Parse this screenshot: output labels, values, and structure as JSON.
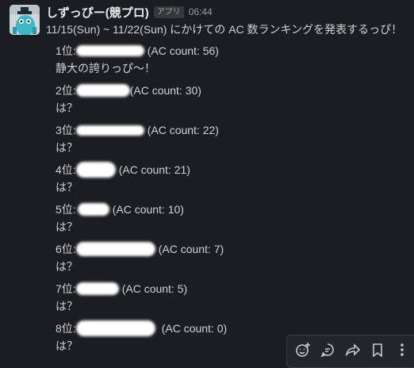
{
  "message": {
    "author": "しずっぴー(競プロ)",
    "badge": "アプリ",
    "time": "06:44",
    "intro": "11/15(Sun) ~ 11/22(Sun) にかけての AC 数ランキングを発表するっぴ！"
  },
  "ranks": [
    {
      "place": "1位:",
      "count": "(AC count: 56)",
      "comment": "静大の誇りっぴ〜！"
    },
    {
      "place": "2位:",
      "count": "(AC count: 30)",
      "comment": "は？"
    },
    {
      "place": "3位:",
      "count": "(AC count: 22)",
      "comment": "は？"
    },
    {
      "place": "4位:",
      "count": "(AC count: 21)",
      "comment": "は？"
    },
    {
      "place": "5位:",
      "count": "(AC count: 10)",
      "comment": "は？"
    },
    {
      "place": "6位:",
      "count": "(AC count: 7)",
      "comment": "は？"
    },
    {
      "place": "7位:",
      "count": "(AC count: 5)",
      "comment": "は？"
    },
    {
      "place": "8位:",
      "count": "(AC count: 0)",
      "comment": "は？"
    }
  ],
  "toolbar": {
    "icons": [
      "emoji-add-icon",
      "reply-thread-icon",
      "share-icon",
      "bookmark-icon",
      "more-icon"
    ]
  }
}
